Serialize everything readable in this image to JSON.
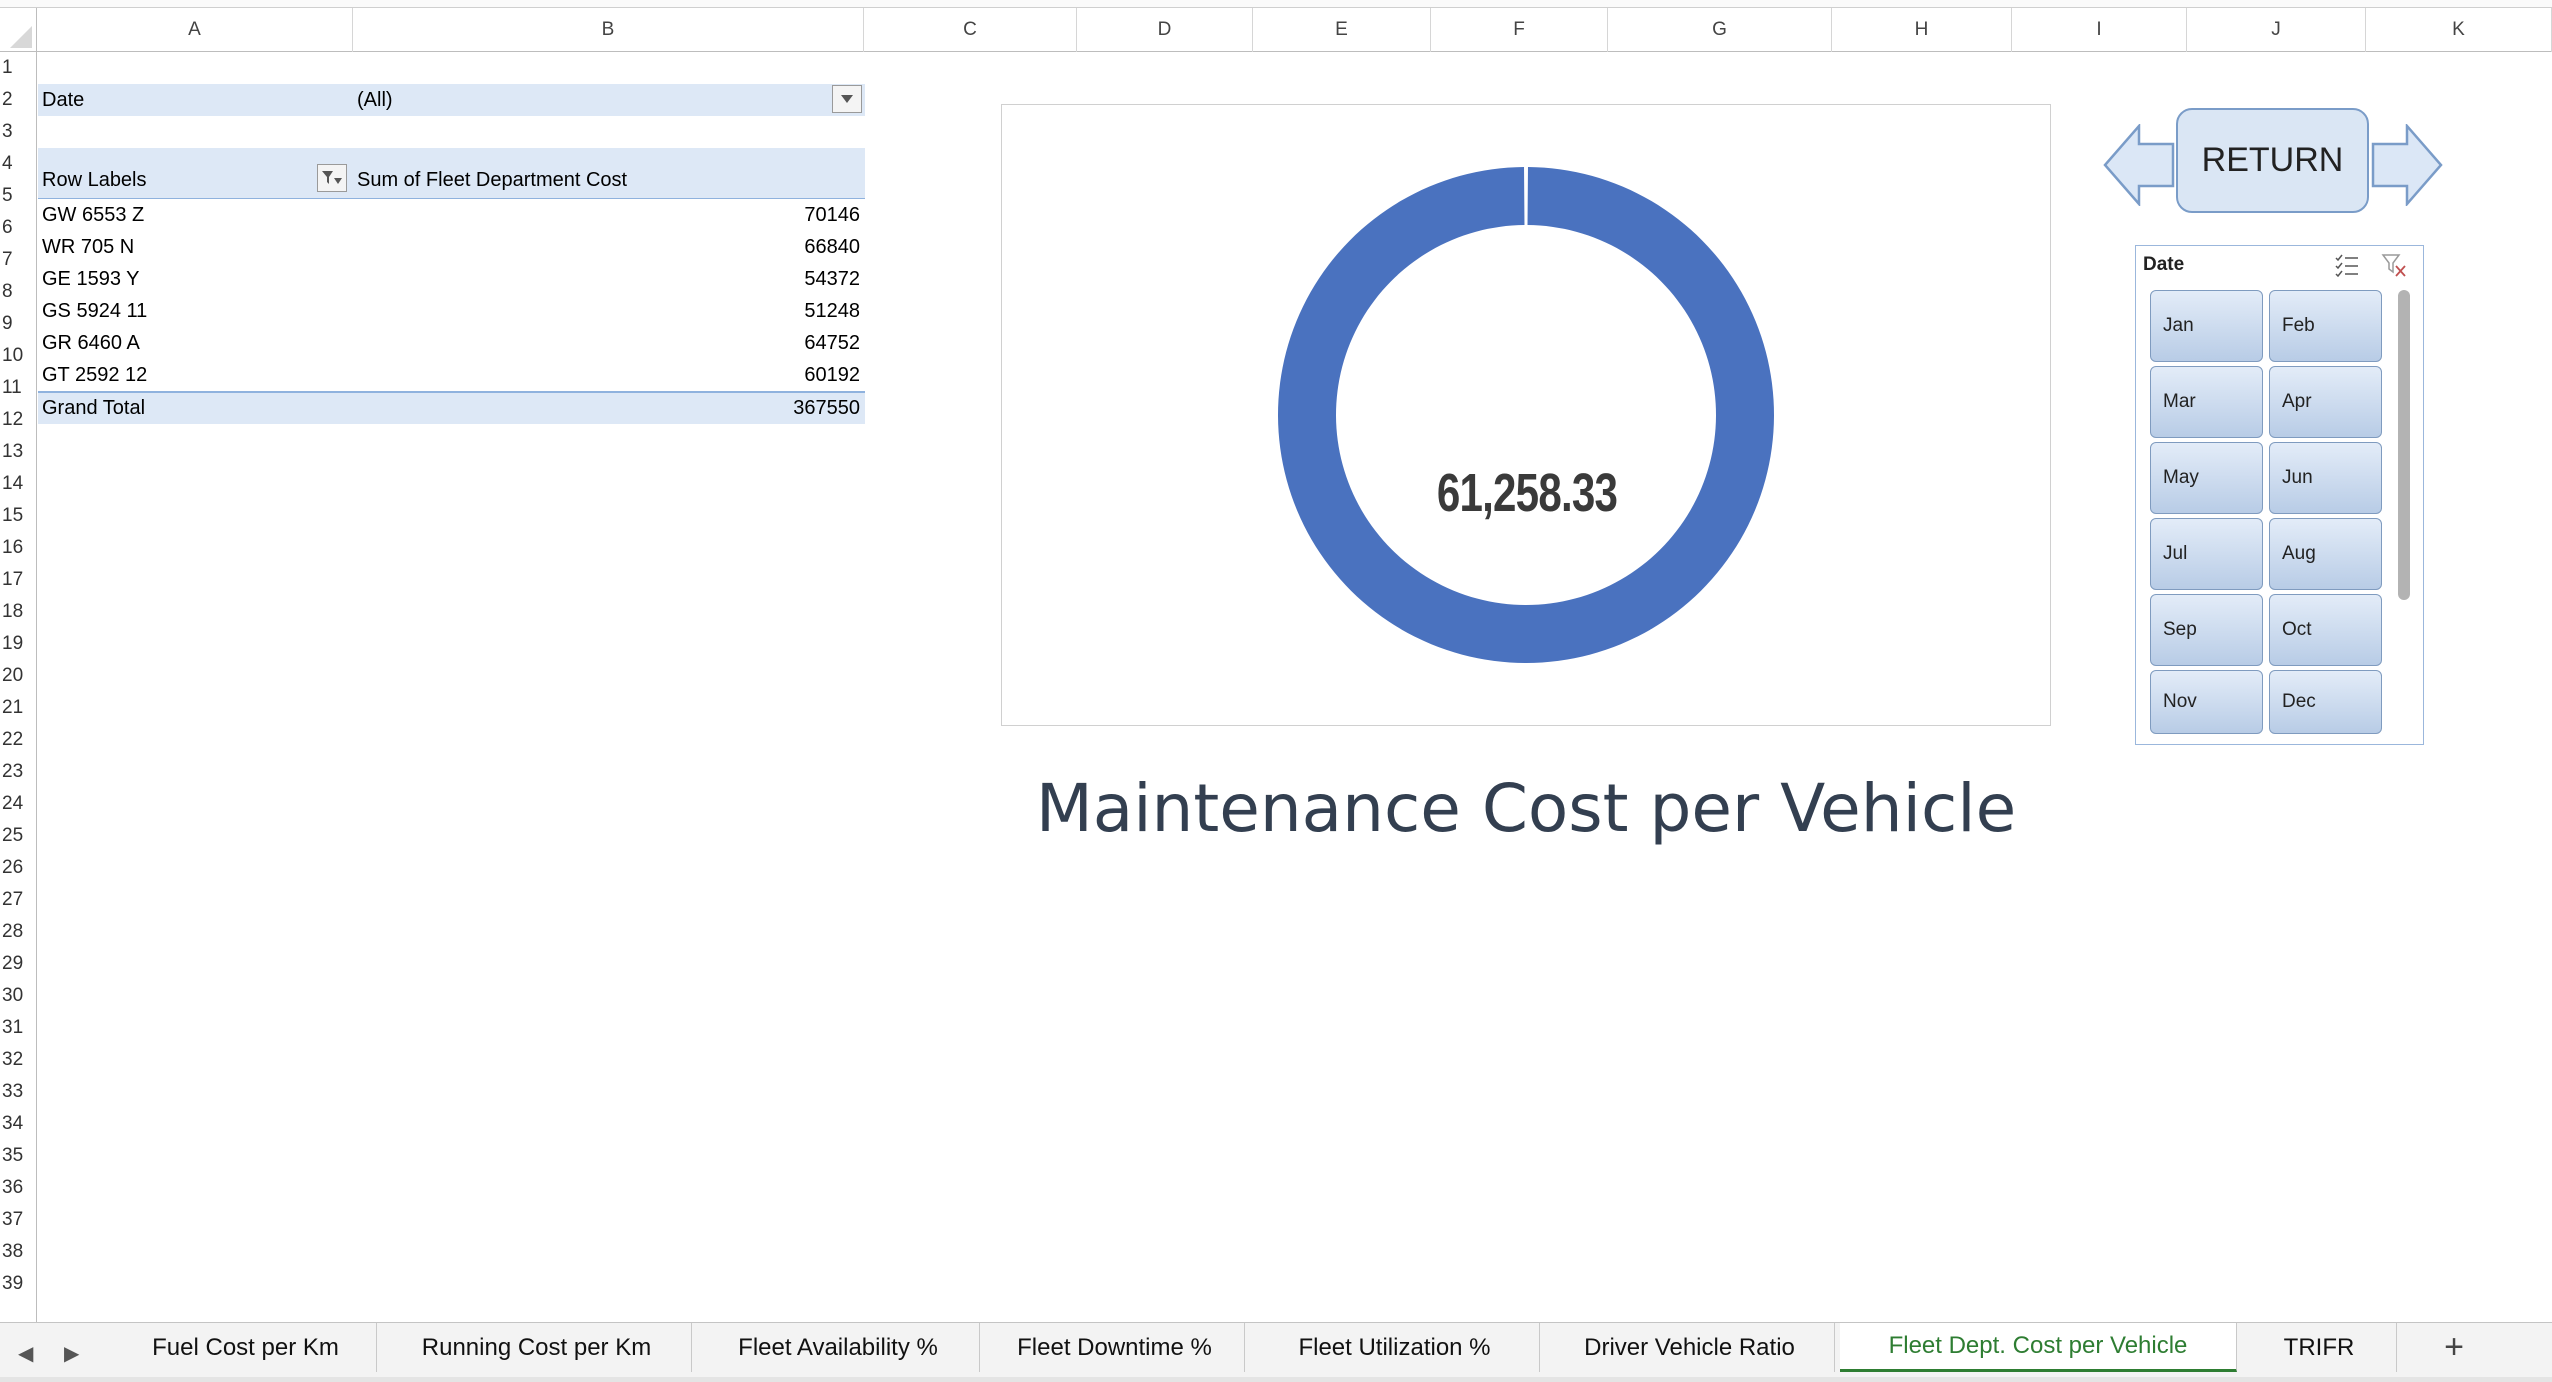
{
  "columns": [
    "A",
    "B",
    "C",
    "D",
    "E",
    "F",
    "G",
    "H",
    "I",
    "J",
    "K"
  ],
  "rows": [
    "1",
    "2",
    "3",
    "4",
    "5",
    "6",
    "7",
    "8",
    "9",
    "10",
    "11",
    "12",
    "13",
    "14",
    "15",
    "16",
    "17",
    "18",
    "19",
    "20",
    "21",
    "22",
    "23",
    "24",
    "25",
    "26",
    "27",
    "28",
    "29",
    "30",
    "31",
    "32",
    "33",
    "34",
    "35",
    "36",
    "37",
    "38",
    "39"
  ],
  "pivot": {
    "filter_label": "Date",
    "filter_value": "(All)",
    "row_labels_header": "Row Labels",
    "value_header": "Sum of Fleet Department Cost",
    "rows": [
      {
        "label": "GW 6553 Z",
        "value": "70146"
      },
      {
        "label": "WR 705 N",
        "value": "66840"
      },
      {
        "label": "GE 1593 Y",
        "value": "54372"
      },
      {
        "label": "GS 5924 11",
        "value": "51248"
      },
      {
        "label": "GR 6460 A",
        "value": "64752"
      },
      {
        "label": "GT 2592 12",
        "value": "60192"
      }
    ],
    "grand_total_label": "Grand Total",
    "grand_total_value": "367550"
  },
  "chart_data": {
    "type": "pie",
    "variant": "doughnut",
    "center_label": "61,258.33",
    "series": [
      {
        "values": [
          100
        ]
      }
    ],
    "color": "#4a72bf"
  },
  "dashboard": {
    "title": "Maintenance Cost per Vehicle",
    "return_label": "RETURN"
  },
  "slicer": {
    "title": "Date",
    "items": [
      "Jan",
      "Feb",
      "Mar",
      "Apr",
      "May",
      "Jun",
      "Jul",
      "Aug",
      "Sep",
      "Oct",
      "Nov",
      "Dec"
    ]
  },
  "tabs": [
    {
      "label": "Fuel Cost per Km",
      "active": false
    },
    {
      "label": "Running Cost per Km",
      "active": false
    },
    {
      "label": "Fleet Availability %",
      "active": false
    },
    {
      "label": "Fleet Downtime %",
      "active": false
    },
    {
      "label": "Fleet Utilization %",
      "active": false
    },
    {
      "label": "Driver Vehicle Ratio",
      "active": false
    },
    {
      "label": "Fleet Dept. Cost per Vehicle",
      "active": true
    },
    {
      "label": "TRIFR",
      "active": false
    }
  ],
  "tab_add_label": "+",
  "colors": {
    "accent_green": "#2e7d32",
    "pivot_band": "#dde8f6",
    "donut_blue": "#4a72bf"
  }
}
